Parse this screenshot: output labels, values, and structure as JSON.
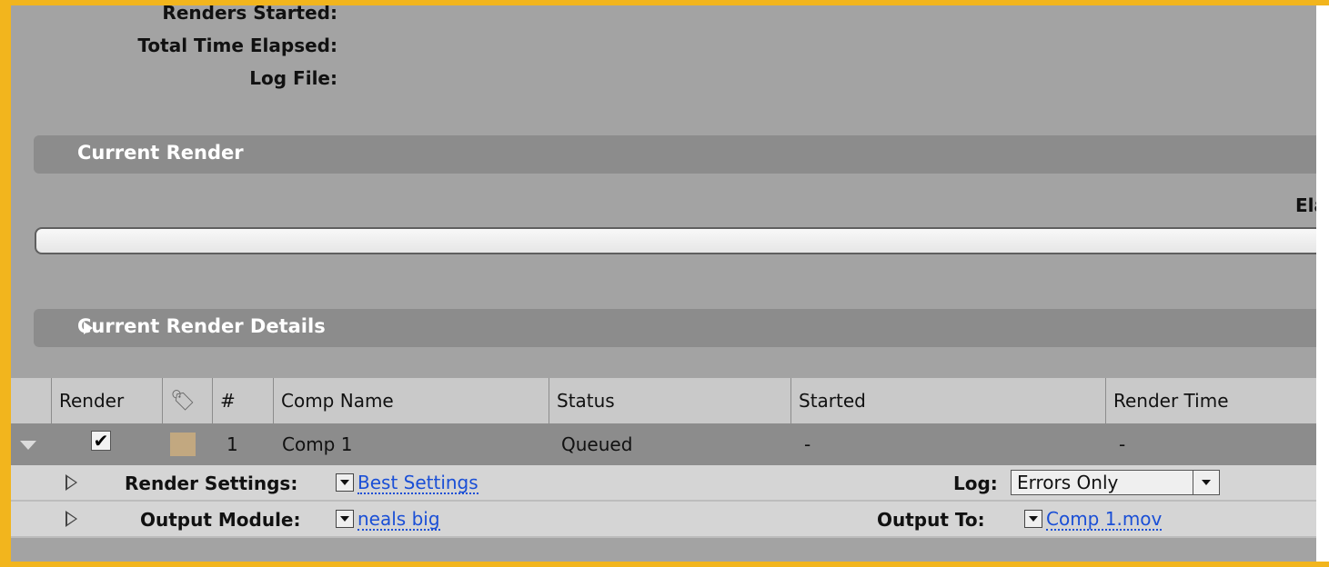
{
  "summary": {
    "renders_started_label": "Renders Started:",
    "total_time_elapsed_label": "Total Time Elapsed:",
    "log_file_label": "Log File:"
  },
  "current_render": {
    "title": "Current Render",
    "elapsed_label": "Ela",
    "progress": 0
  },
  "current_render_details": {
    "title": "Current Render Details"
  },
  "queue": {
    "columns": {
      "render": "Render",
      "number": "#",
      "comp_name": "Comp Name",
      "status": "Status",
      "started": "Started",
      "render_time": "Render Time"
    },
    "items": [
      {
        "checked": "✔",
        "label_color": "#c2a880",
        "number": "1",
        "comp_name": "Comp 1",
        "status": "Queued",
        "started": "-",
        "render_time": "-",
        "render_settings_label": "Render Settings:",
        "render_settings_value": "Best Settings",
        "log_label": "Log:",
        "log_value": "Errors Only",
        "output_module_label": "Output Module:",
        "output_module_value": "neals big",
        "output_to_label": "Output To:",
        "output_to_value": "Comp 1.mov"
      }
    ]
  },
  "icons": {
    "label_column": "tag-icon",
    "expand": "disclosure-triangle-icon",
    "dropdown": "dropdown-arrow-icon"
  },
  "colors": {
    "frame_border": "#f2b51d",
    "panel_bg": "#a3a3a3",
    "section_bar": "#8c8c8c",
    "link": "#1a4fd6"
  }
}
